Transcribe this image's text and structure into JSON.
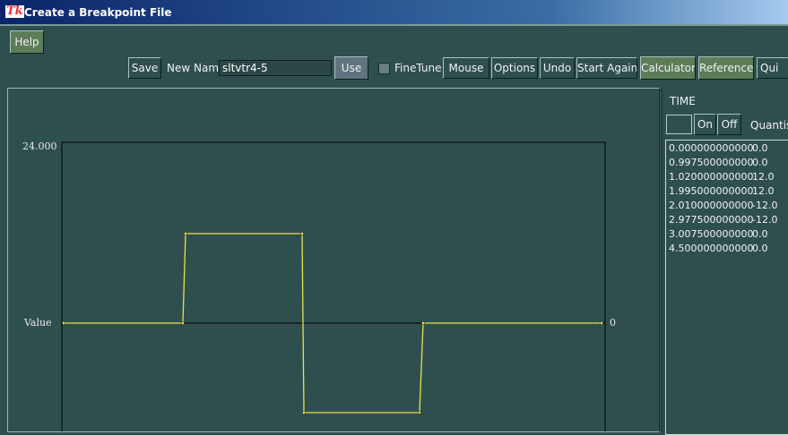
{
  "window": {
    "title": "Create a Breakpoint File",
    "tk_logo": "Tk"
  },
  "toolbar": {
    "help": "Help",
    "save": "Save",
    "new_name_label": "New Name",
    "name_value": "sltvtr4-5",
    "use": "Use",
    "finetune": "FineTune",
    "mouse": "Mouse",
    "options": "Options",
    "undo": "Undo",
    "start_again": "Start Again",
    "calculator": "Calculator",
    "reference": "Reference",
    "quit": "Qui"
  },
  "graph": {
    "y_max_label": "24.000",
    "value_label": "Value",
    "zero_label": "0",
    "points": [
      {
        "time": 0.0,
        "value": 0.0
      },
      {
        "time": 0.9975,
        "value": 0.0
      },
      {
        "time": 1.02,
        "value": 12.0
      },
      {
        "time": 1.995,
        "value": 12.0
      },
      {
        "time": 2.01,
        "value": -12.0
      },
      {
        "time": 2.9775,
        "value": -12.0
      },
      {
        "time": 3.0075,
        "value": 0.0
      },
      {
        "time": 4.5,
        "value": 0.0
      }
    ],
    "time_range": [
      0,
      4.5
    ],
    "value_range": [
      -24,
      24
    ],
    "line_color": "#e6e24a",
    "axis_color": "#000000"
  },
  "side": {
    "time_label": "TIME",
    "on": "On",
    "off": "Off",
    "quantise": "Quantise",
    "rows": [
      {
        "time": "0.000000000000",
        "value": "0.0"
      },
      {
        "time": "0.997500000000",
        "value": "0.0"
      },
      {
        "time": "1.020000000000",
        "value": "12.0"
      },
      {
        "time": "1.995000000000",
        "value": "12.0"
      },
      {
        "time": "2.010000000000",
        "value": "-12.0"
      },
      {
        "time": "2.977500000000",
        "value": "-12.0"
      },
      {
        "time": "3.007500000000",
        "value": "0.0"
      },
      {
        "time": "4.500000000000",
        "value": "0.0"
      }
    ]
  }
}
